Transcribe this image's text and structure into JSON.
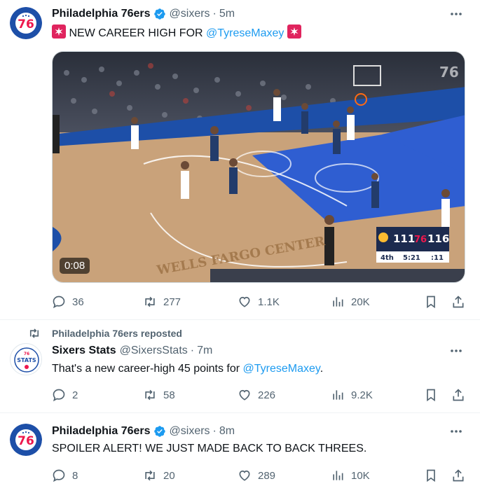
{
  "tweets": [
    {
      "name": "Philadelphia 76ers",
      "handle": "@sixers",
      "time": "5m",
      "text_before": "NEW CAREER HIGH FOR ",
      "mention": "@TyreseMaxey",
      "video": {
        "duration": "0:08",
        "scoreboard": {
          "away": "111",
          "home": "116",
          "quarter": "4th",
          "clock": "5:21",
          "shot_clock": ":11"
        },
        "arena_text": "WELLS FARGO CENTER"
      },
      "stats": {
        "replies": "36",
        "reposts": "277",
        "likes": "1.1K",
        "views": "20K"
      }
    },
    {
      "repost_label": "Philadelphia 76ers reposted",
      "name": "Sixers Stats",
      "handle": "@SixersStats",
      "time": "7m",
      "avatar_text": "STATS",
      "text_before": "That's a new career-high 45 points for ",
      "mention": "@TyreseMaxey",
      "text_after": ".",
      "stats": {
        "replies": "2",
        "reposts": "58",
        "likes": "226",
        "views": "9.2K"
      }
    },
    {
      "name": "Philadelphia 76ers",
      "handle": "@sixers",
      "time": "8m",
      "text": "SPOILER ALERT! WE JUST MADE BACK TO BACK THREES.",
      "stats": {
        "replies": "8",
        "reposts": "20",
        "likes": "289",
        "views": "10K"
      }
    }
  ],
  "colors": {
    "brand_blue": "#1d9bf0",
    "sixers_blue": "#1d4fa8",
    "sixers_red": "#ed174c",
    "muted": "#536471"
  },
  "icons": [
    "verified-badge-icon",
    "siren-icon",
    "reply-icon",
    "repost-icon",
    "like-icon",
    "views-icon",
    "bookmark-icon",
    "share-icon",
    "more-icon"
  ]
}
